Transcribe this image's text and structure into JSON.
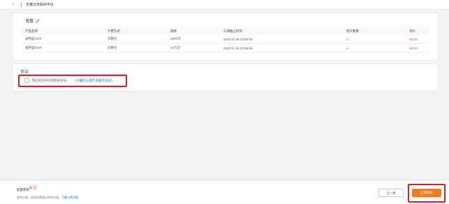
{
  "header": {
    "back_icon": "‹",
    "title": "天翼云体验AI平台"
  },
  "config": {
    "label": "配置",
    "columns": [
      "产品名称",
      "计费方式",
      "规格",
      "公测截止时间",
      "购买数量",
      "单价"
    ],
    "rows": [
      [
        "通用型OCR",
        "次数包",
        "1000次",
        "2020-11-30 23:59:59",
        "1",
        "¥0.00"
      ],
      [
        "通用型OCR",
        "次数包",
        "10万次",
        "2020-11-30 23:59:59",
        "1",
        "¥0.00"
      ]
    ]
  },
  "agreement": {
    "title": "协议",
    "checkbox_label": "我已阅读并同意相关协议。",
    "link_text": "《天翼云公测产品服务协议》"
  },
  "footer": {
    "fee_label": "配置费用",
    "fee_value": "¥ 0",
    "note": "参考价格，具体扣费请以账单为准。",
    "note_link": "了解计费详情",
    "prev_label": "上一步",
    "buy_label": "立即购买"
  },
  "colors": {
    "accent": "#f27b21",
    "price": "#f15a24",
    "link": "#1a73e8",
    "highlight": "#e01e1e"
  }
}
